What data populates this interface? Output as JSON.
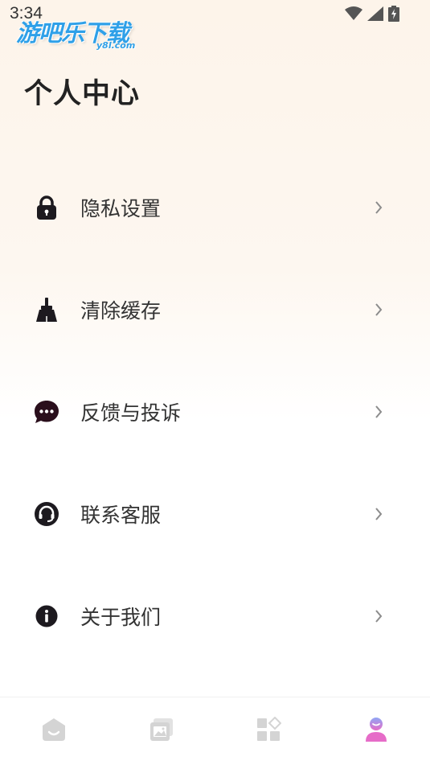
{
  "status_bar": {
    "time": "3:34",
    "icons": [
      "wifi-icon",
      "signal-icon",
      "battery-charging-icon"
    ]
  },
  "watermark": {
    "text": "游吧乐下载",
    "sub": "y8l.com"
  },
  "page": {
    "title": "个人中心"
  },
  "menu": {
    "items": [
      {
        "label": "隐私设置",
        "icon": "lock-icon"
      },
      {
        "label": "清除缓存",
        "icon": "broom-icon"
      },
      {
        "label": "反馈与投诉",
        "icon": "chat-bubble-icon"
      },
      {
        "label": "联系客服",
        "icon": "headset-icon"
      },
      {
        "label": "关于我们",
        "icon": "info-icon"
      }
    ]
  },
  "bottom_nav": {
    "items": [
      {
        "icon": "home-icon",
        "active": false
      },
      {
        "icon": "gallery-icon",
        "active": false
      },
      {
        "icon": "apps-icon",
        "active": false
      },
      {
        "icon": "profile-icon",
        "active": true
      }
    ]
  },
  "colors": {
    "inactive_icon": "#d4d4d4",
    "active_icon_top": "#8fa6f5",
    "active_icon_bottom": "#e66cc8",
    "icon_dark": "#1d1a1f",
    "chevron": "#8c8c8c",
    "watermark": "#2fa0e8"
  }
}
